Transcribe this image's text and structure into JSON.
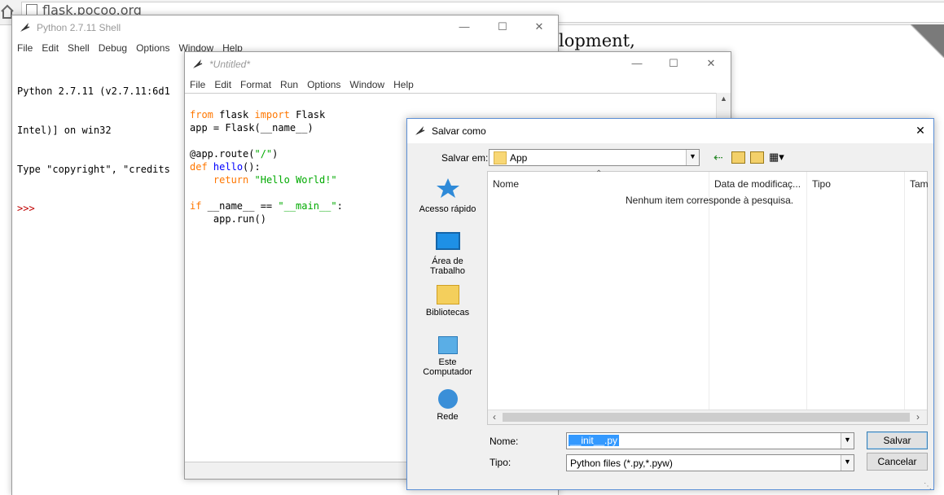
{
  "browser": {
    "url": "flask.pocoo.org",
    "page_fragment": "lopment,"
  },
  "shell_window": {
    "title": "Python 2.7.11 Shell",
    "menu": [
      "File",
      "Edit",
      "Shell",
      "Debug",
      "Options",
      "Window",
      "Help"
    ],
    "lines": [
      "Python 2.7.11 (v2.7.11:6d1",
      "Intel)] on win32",
      "Type \"copyright\", \"credits",
      ">>>"
    ]
  },
  "editor_window": {
    "title": "*Untitled*",
    "menu": [
      "File",
      "Edit",
      "Format",
      "Run",
      "Options",
      "Window",
      "Help"
    ]
  },
  "dialog": {
    "title": "Salvar como",
    "save_in_label": "Salvar em:",
    "save_in_value": "App",
    "places": [
      "Acesso rápido",
      "Área de Trabalho",
      "Bibliotecas",
      "Este Computador",
      "Rede"
    ],
    "columns": [
      "Nome",
      "Data de modificaç...",
      "Tipo",
      "Tam"
    ],
    "empty_message": "Nenhum item corresponde à pesquisa.",
    "filename_label": "Nome:",
    "filename_value": "__init__.py",
    "type_label": "Tipo:",
    "type_value": "Python files (*.py,*.pyw)",
    "save_button": "Salvar",
    "cancel_button": "Cancelar"
  },
  "colors": {
    "keyword": "#ff7700",
    "function": "#0000ff",
    "string": "#00aa00",
    "prompt": "#c00000",
    "selection": "#3399ff"
  }
}
